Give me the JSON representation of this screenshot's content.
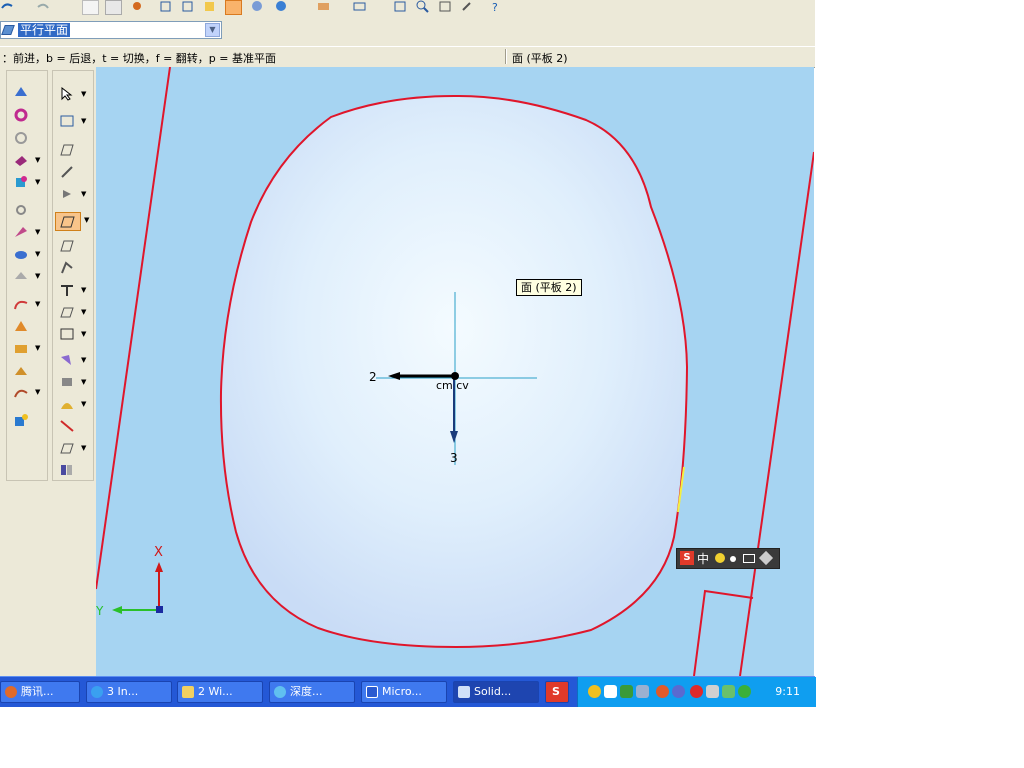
{
  "plane_selector": {
    "value": "平行平面"
  },
  "hint_bar": {
    "shortcuts": "：前进，b = 后退，t = 切换，f = 翻转，p = 基准平面",
    "status": "面 (平板 2)"
  },
  "viewport": {
    "tooltip": "面 (平板 2)",
    "axis_label_2": "2",
    "axis_label_3": "3",
    "center_label": "cm cv",
    "triad_x": "X",
    "triad_y": "Y"
  },
  "ime_toolbar": {
    "label": "中"
  },
  "taskbar": {
    "items": [
      {
        "label": "腾讯..."
      },
      {
        "label": "3 In..."
      },
      {
        "label": "2 Wi..."
      },
      {
        "label": "深度..."
      },
      {
        "label": "Micro..."
      },
      {
        "label": "Solid..."
      }
    ],
    "clock": "9:11"
  },
  "colors": {
    "viewport_bg": "#a6d4f2",
    "edge_red": "#e0162b",
    "taskbar": "#2458d6",
    "tray": "#0f9ef0"
  }
}
